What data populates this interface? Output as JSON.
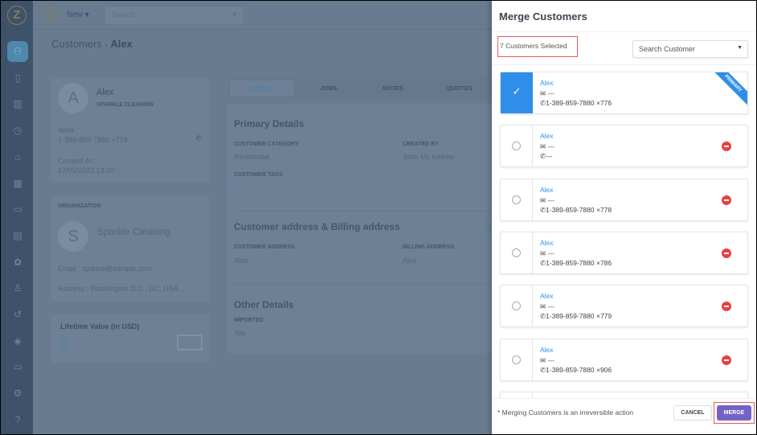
{
  "app": {
    "logo_letter": "Z",
    "new_label": "New ▾",
    "search_placeholder": "Search..."
  },
  "sidebar": {
    "icons": [
      "customers-icon",
      "mobile-icon",
      "map-icon",
      "clock-icon",
      "tag-icon",
      "calculator-icon",
      "briefcase-icon",
      "book-icon",
      "team-icon",
      "user-icon",
      "history-icon",
      "layers-icon",
      "monitor-icon",
      "settings-icon",
      "help-icon"
    ],
    "glyphs": [
      "⚇",
      "▯",
      "▥",
      "◷",
      "⌂",
      "▦",
      "▭",
      "▤",
      "✿",
      "♙",
      "↺",
      "◈",
      "▭",
      "⚙",
      "?"
    ]
  },
  "breadcrumb": {
    "parent": "Customers",
    "sep": "›",
    "current": "Alex"
  },
  "profile": {
    "initial": "A",
    "name": "Alex",
    "company": "SPARKLE CLEANING",
    "work_label": "Work :",
    "work_phone": "1-389-859-7880 ×776",
    "created_label": "Created At :",
    "created_value": "17/05/2022 13:30"
  },
  "organization": {
    "heading": "ORGANIZATION",
    "initial": "S",
    "name": "Sparkle Cleaning",
    "email": "Email : sparkle@sample.com",
    "address": "Address : Washington D.C., DC, USA, , ,"
  },
  "lifetime": {
    "label": "Lifetime Value (in USD)",
    "value": "0"
  },
  "tabs": [
    {
      "label": "DETAILS"
    },
    {
      "label": "JOBS"
    },
    {
      "label": "NOTES"
    },
    {
      "label": "QUOTES"
    }
  ],
  "details": {
    "primary_heading": "Primary Details",
    "category_label": "CUSTOMER CATEGORY",
    "category_value": "Residential",
    "created_by_label": "CREATED BY",
    "created_by_value": "John Mc Keever",
    "tags_label": "CUSTOMER TAGS",
    "tags_value": "—",
    "address_heading": "Customer address & Billing address",
    "address_link": "M",
    "cust_addr_label": "CUSTOMER ADDRESS",
    "cust_addr_value": "Alex",
    "bill_addr_label": "BILLING ADDRESS",
    "bill_addr_value": "Alex",
    "other_heading": "Other Details",
    "imported_label": "IMPORTED",
    "imported_value": "Yes"
  },
  "modal": {
    "title": "Merge Customers",
    "selected_count": "7 Customers Selected",
    "search_placeholder": "Search Customer",
    "primary_badge": "PRIMARY",
    "note": "* Merging Customers is an irreversible action",
    "cancel": "CANCEL",
    "merge": "MERGE",
    "accent": "#2f8fe8",
    "merge_color": "#7562c4",
    "customers": [
      {
        "name": "Alex",
        "email": "---",
        "phone": "1-389-859-7880 ×776",
        "primary": true
      },
      {
        "name": "Alex",
        "email": "---",
        "phone": "---",
        "primary": false
      },
      {
        "name": "Alex",
        "email": "---",
        "phone": "1-389-859-7880 ×778",
        "primary": false
      },
      {
        "name": "Alex",
        "email": "---",
        "phone": "1-389-859-7880 ×786",
        "primary": false
      },
      {
        "name": "Alex",
        "email": "---",
        "phone": "1-389-859-7880 ×779",
        "primary": false
      },
      {
        "name": "Alex",
        "email": "---",
        "phone": "1-389-859-7880 ×906",
        "primary": false
      },
      {
        "name": "",
        "email": "",
        "phone": "",
        "primary": false
      }
    ]
  }
}
